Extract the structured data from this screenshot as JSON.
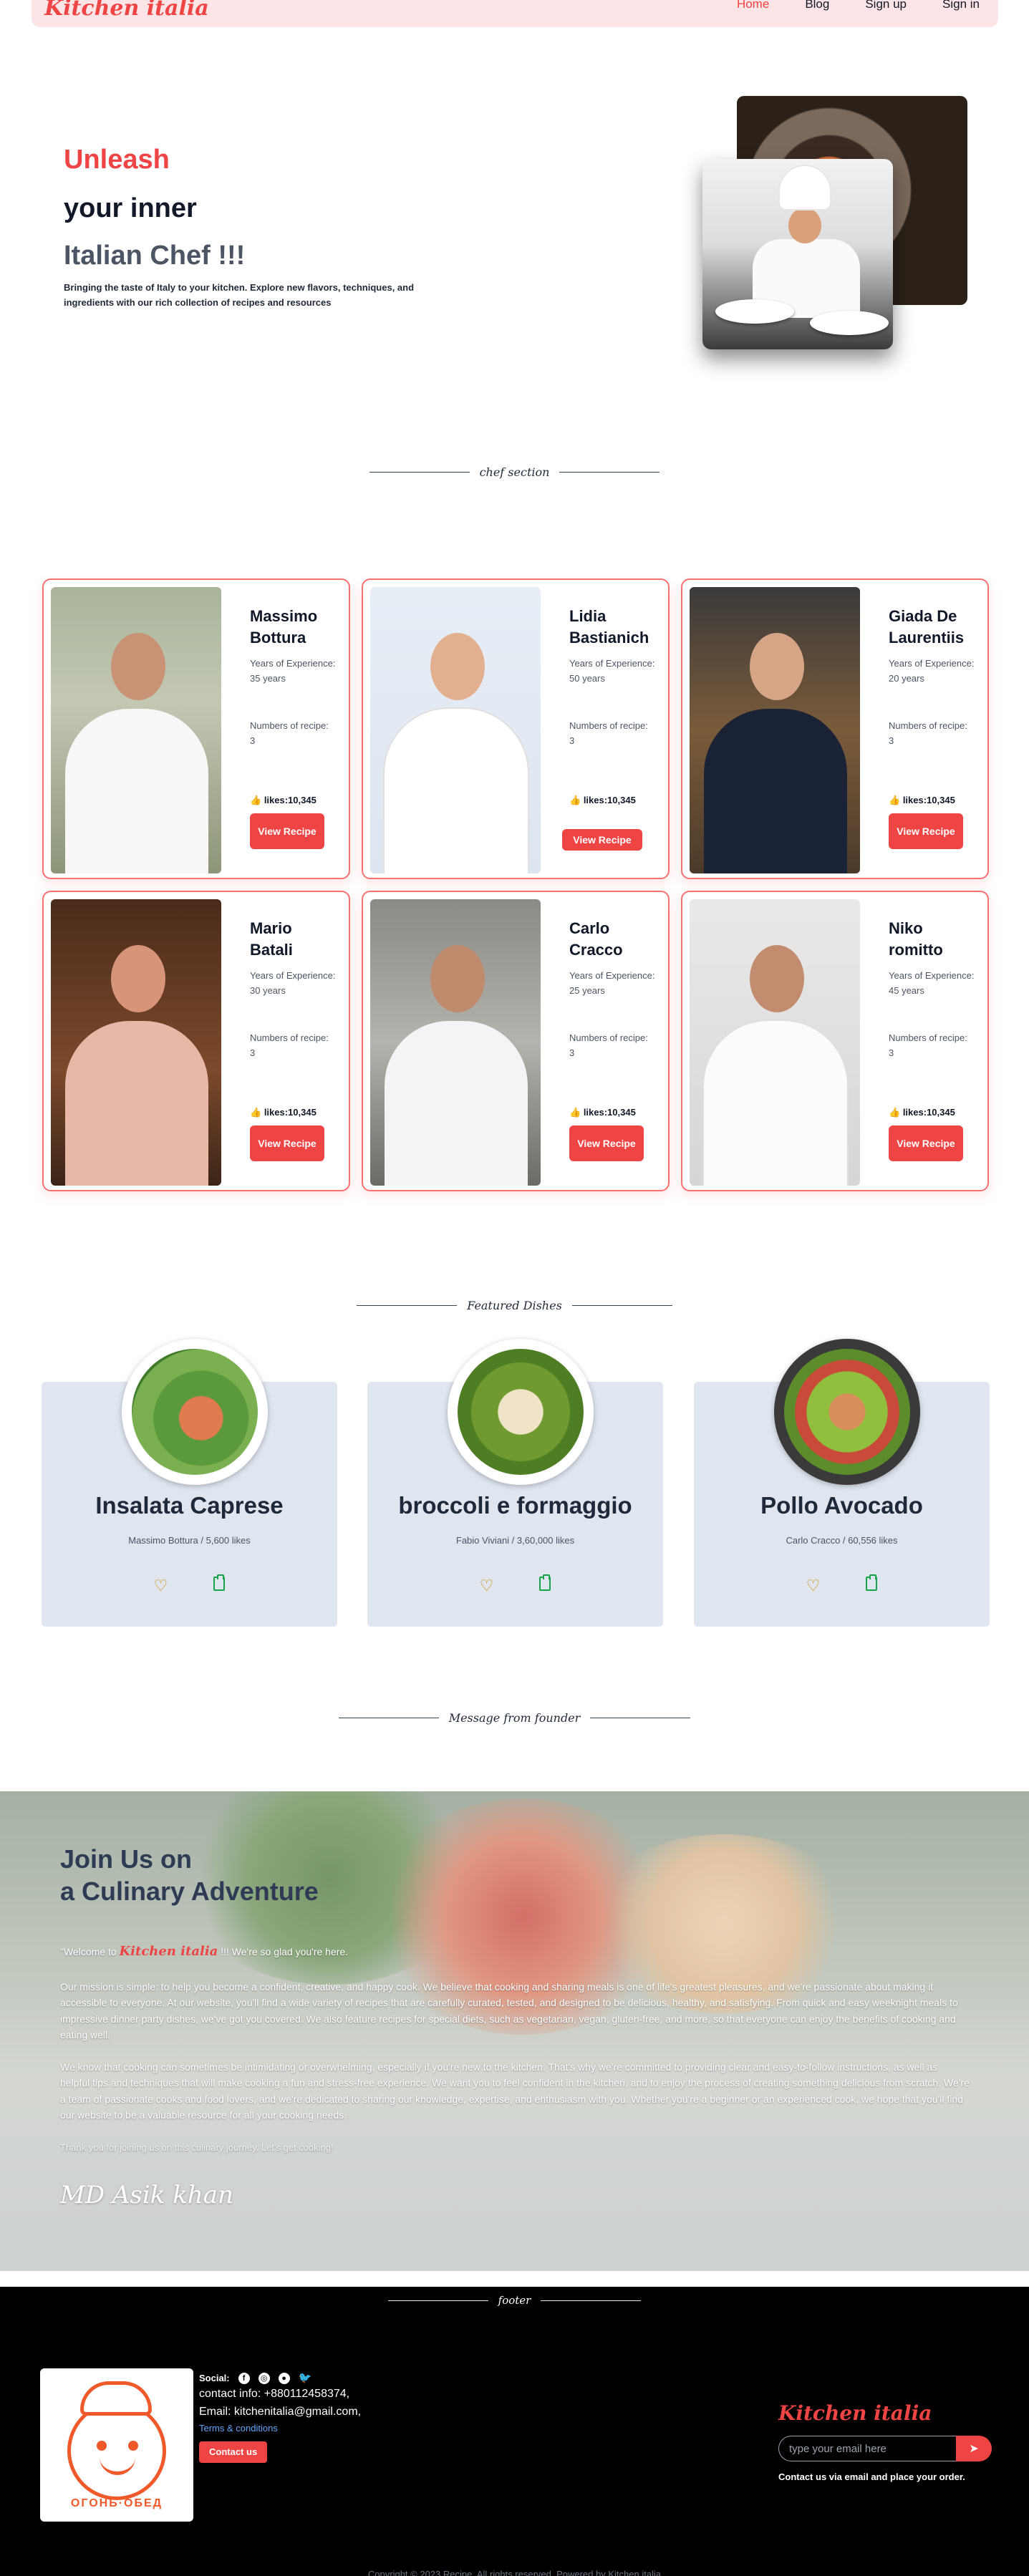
{
  "nav": {
    "brand": "Kitchen italia",
    "links": [
      "Home",
      "Blog",
      "Sign up",
      "Sign in"
    ]
  },
  "hero": {
    "line1": "Unleash",
    "line2": "your inner",
    "line3": "Italian Chef !!!",
    "subtitle": "Bringing the taste of Italy to your kitchen. Explore new flavors, techniques, and ingredients with our rich collection of recipes and resources"
  },
  "chef_section": {
    "label": "chef section",
    "chefs": [
      {
        "name": "Massimo Bottura",
        "experience": "Years of Experience: 35 years",
        "recipes": "Numbers of recipe: 3",
        "likes": "likes:10,345",
        "button": "View Recipe"
      },
      {
        "name": "Lidia Bastianich",
        "experience": "Years of Experience: 50 years",
        "recipes": "Numbers of recipe: 3",
        "likes": "likes:10,345",
        "button": "View Recipe"
      },
      {
        "name": "Giada De Laurentiis",
        "experience": "Years of Experience: 20 years",
        "recipes": "Numbers of recipe: 3",
        "likes": "likes:10,345",
        "button": "View Recipe"
      },
      {
        "name": "Mario Batali",
        "experience": "Years of Experience: 30 years",
        "recipes": "Numbers of recipe: 3",
        "likes": "likes:10,345",
        "button": "View Recipe"
      },
      {
        "name": "Carlo Cracco",
        "experience": "Years of Experience: 25 years",
        "recipes": "Numbers of recipe: 3",
        "likes": "likes:10,345",
        "button": "View Recipe"
      },
      {
        "name": "Niko romitto",
        "experience": "Years of Experience: 45 years",
        "recipes": "Numbers of recipe: 3",
        "likes": "likes:10,345",
        "button": "View Recipe"
      }
    ]
  },
  "featured": {
    "label": "Featured Dishes",
    "dishes": [
      {
        "name": "Insalata Caprese",
        "meta": "Massimo Bottura / 5,600 likes"
      },
      {
        "name": "broccoli e formaggio",
        "meta": "Fabio Viviani / 3,60,000 likes"
      },
      {
        "name": "Pollo Avocado",
        "meta": "Carlo Cracco / 60,556 likes"
      }
    ]
  },
  "founder": {
    "label": "Message from founder",
    "title_line1": "Join Us on",
    "title_line2": "a Culinary Adventure",
    "welcome_prefix": "\"Welcome to ",
    "welcome_brand": "Kitchen italia",
    "welcome_suffix": " !!! We're so glad you're here.",
    "paragraph1": "Our mission is simple: to help you become a confident, creative, and happy cook. We believe that cooking and sharing meals is one of life's greatest pleasures, and we're passionate about making it accessible to everyone. At our website, you'll find a wide variety of recipes that are carefully curated, tested, and designed to be delicious, healthy, and satisfying. From quick and easy weeknight meals to impressive dinner party dishes, we've got you covered. We also feature recipes for special diets, such as vegetarian, vegan, gluten-free, and more, so that everyone can enjoy the benefits of cooking and eating well.",
    "paragraph2": "We know that cooking can sometimes be intimidating or overwhelming, especially if you're new to the kitchen. That's why we're committed to providing clear and easy-to-follow instructions, as well as helpful tips and techniques that will make cooking a fun and stress-free experience. We want you to feel confident in the kitchen, and to enjoy the process of creating something delicious from scratch. We're a team of passionate cooks and food lovers, and we're dedicated to sharing our knowledge, expertise, and enthusiasm with you. Whether you're a beginner or an experienced cook, we hope that you'll find our website to be a valuable resource for all your cooking needs.",
    "thanks": "Thank you for joining us on this culinary journey. Let's get cooking!",
    "signature": "MD Asik khan"
  },
  "footer": {
    "label": "footer",
    "logo_caption": "ОГОНЬ·ОБЕД",
    "social_label": "Social:",
    "social_icons": [
      "facebook-icon",
      "instagram-icon",
      "github-icon",
      "twitter-icon"
    ],
    "contact": "contact info: +880112458374,",
    "email": "Email: kitchenitalia@gmail.com,",
    "terms": "Terms & conditions",
    "contact_button": "Contact us",
    "brand": "Kitchen italia",
    "subscribe_placeholder": "type your email here",
    "subscribe_note": "Contact us via email and place your order.",
    "copyright": "Copyright © 2023 Recipe. All rights reserved. Powered by Kitchen italia"
  },
  "colors": {
    "accent": "#ef4444",
    "nav_bg": "#fde4e6",
    "dish_card_bg": "#dfe6f0",
    "footer_bg": "#000000"
  }
}
